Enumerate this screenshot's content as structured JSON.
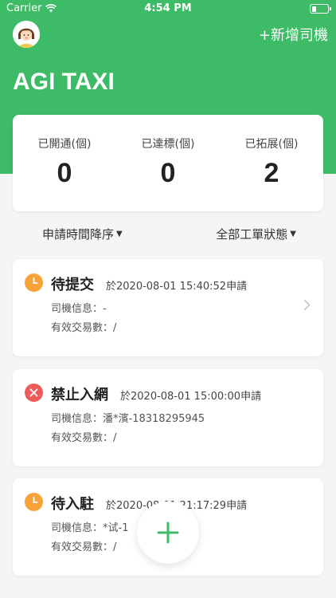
{
  "status_bar": {
    "carrier": "Carrier",
    "time": "4:54 PM"
  },
  "header": {
    "add_driver": "+新增司機",
    "title": "AGI TAXI"
  },
  "stats": [
    {
      "label": "已開通(個)",
      "value": "0"
    },
    {
      "label": "已達標(個)",
      "value": "0"
    },
    {
      "label": "已拓展(個)",
      "value": "2"
    }
  ],
  "filters": {
    "sort": "申請時間降序",
    "status": "全部工單狀態"
  },
  "cards": [
    {
      "status": "待提交",
      "date": "於2020-08-01 15:40:52申請",
      "driver_info": "司機信息：-",
      "valid_trades": "有效交易數：/",
      "icon": "clock-icon"
    },
    {
      "status": "禁止入網",
      "date": "於2020-08-01 15:00:00申請",
      "driver_info": "司機信息：潘*濱-18318295945",
      "valid_trades": "有效交易數：/",
      "icon": "x-icon"
    },
    {
      "status": "待入駐",
      "date": "於2020-08-01 21:17:29申請",
      "driver_info": "司機信息：*试-1",
      "valid_trades": "有效交易數：/",
      "icon": "clock-icon"
    }
  ],
  "colors": {
    "brand": "#3ebb66",
    "pending": "#f7a33a",
    "banned": "#ee5b5b"
  },
  "fab": {
    "icon": "plus-icon"
  }
}
